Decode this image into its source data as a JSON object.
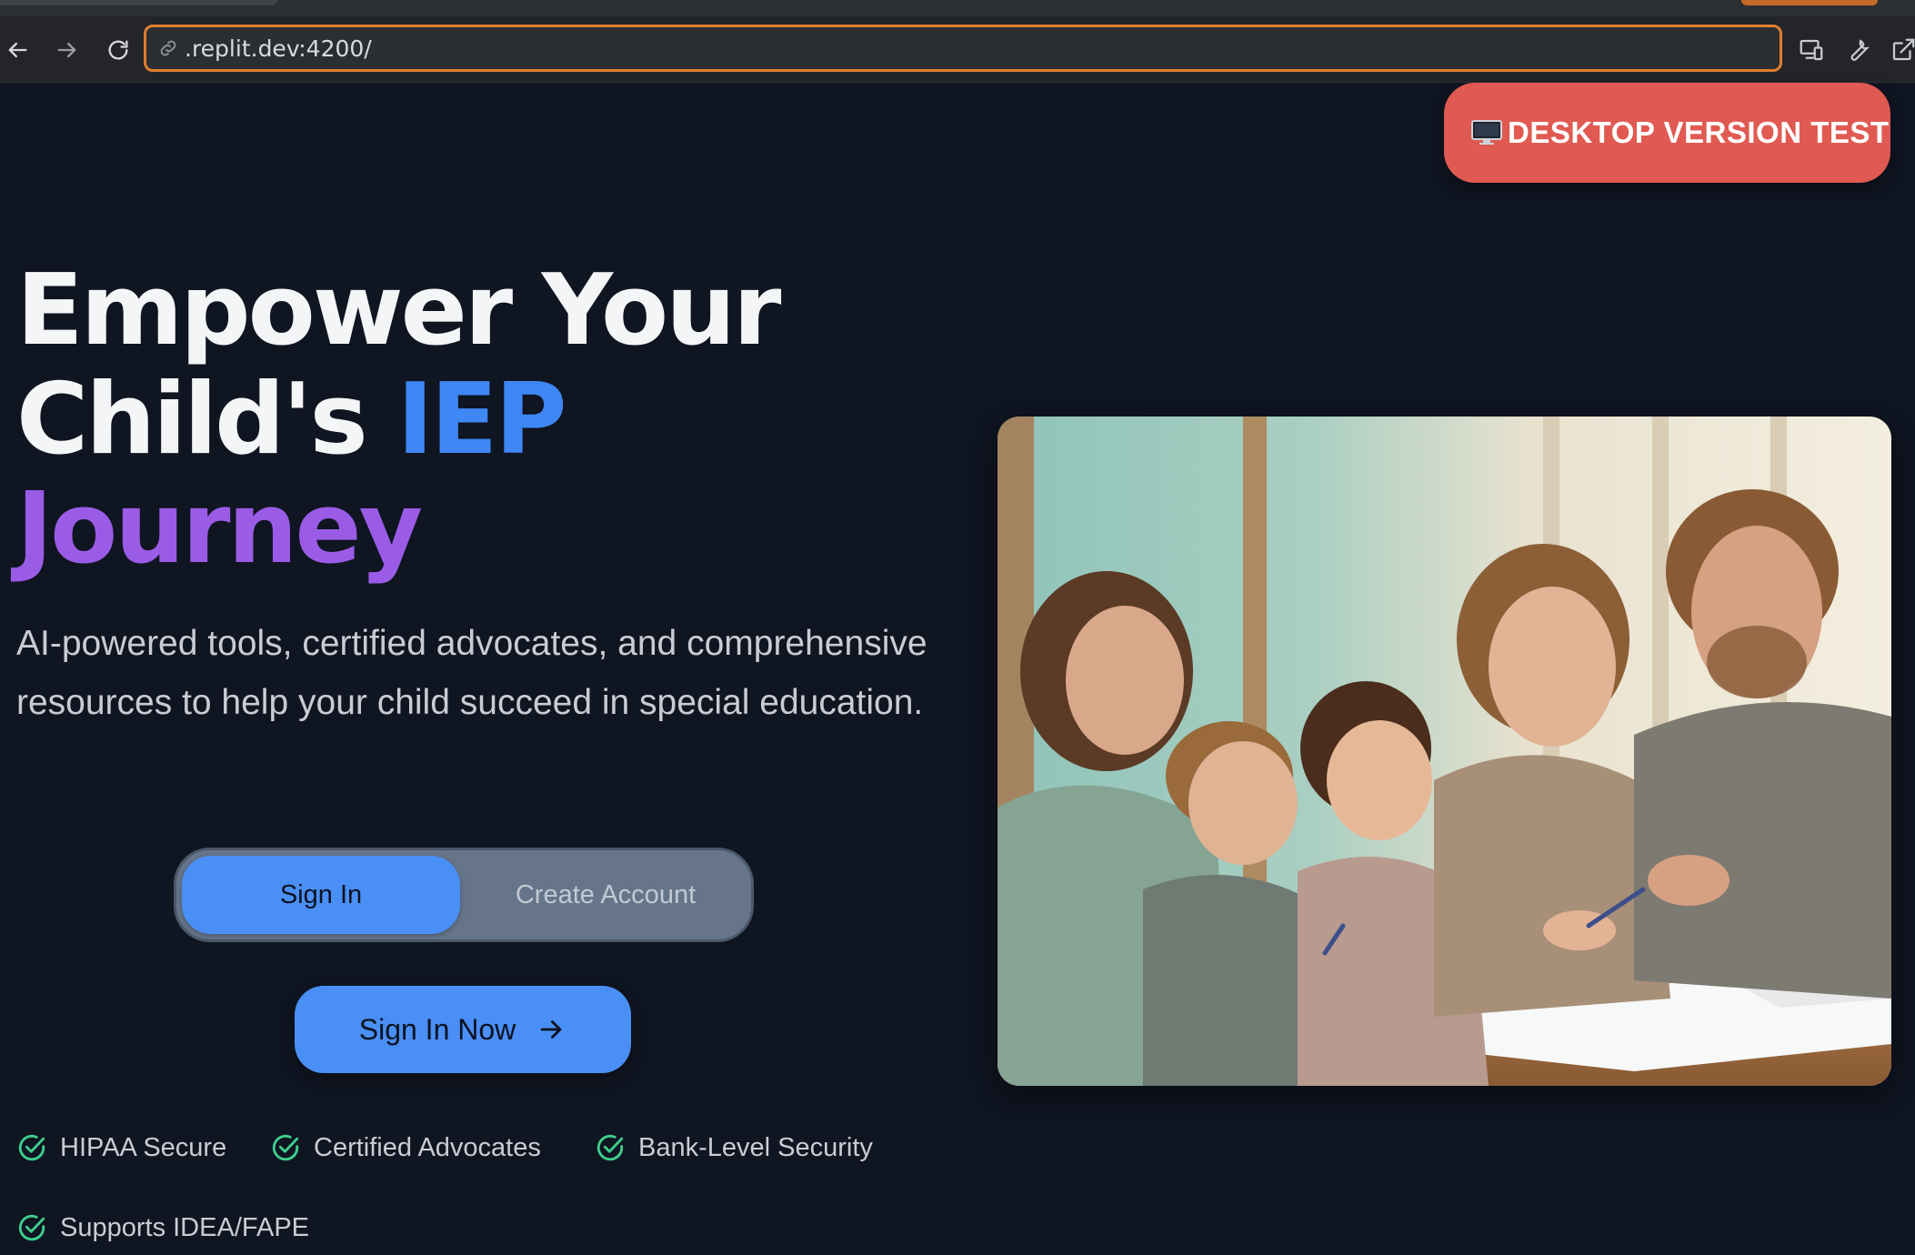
{
  "browser": {
    "url": ".replit.dev:4200/",
    "back_icon": "back-arrow-icon",
    "forward_icon": "forward-arrow-icon",
    "reload_icon": "reload-icon"
  },
  "badge": {
    "icon": "monitor-icon",
    "label": "DESKTOP VERSION TEST",
    "color": "#e05a52"
  },
  "hero": {
    "title_line1": "Empower Your",
    "title_line2_a": "Child's ",
    "title_line2_b": "IEP",
    "title_line3": "Journey",
    "subtitle": "AI-powered tools, certified advocates, and comprehensive resources to help your child succeed in special education."
  },
  "auth": {
    "toggle": [
      "Sign In",
      "Create Account"
    ],
    "active": "Sign In",
    "cta_label": "Sign In Now"
  },
  "features": [
    {
      "label": "HIPAA Secure",
      "icon": "check-circle-icon"
    },
    {
      "label": "Certified Advocates",
      "icon": "check-circle-icon"
    },
    {
      "label": "Bank-Level Security",
      "icon": "check-circle-icon"
    },
    {
      "label": "Supports IDEA/FAPE",
      "icon": "check-circle-icon"
    }
  ],
  "colors": {
    "background": "#0f1521",
    "accent_blue": "#3f87f5",
    "accent_purple": "#9a5ce6",
    "check_green": "#3ecf8e"
  }
}
